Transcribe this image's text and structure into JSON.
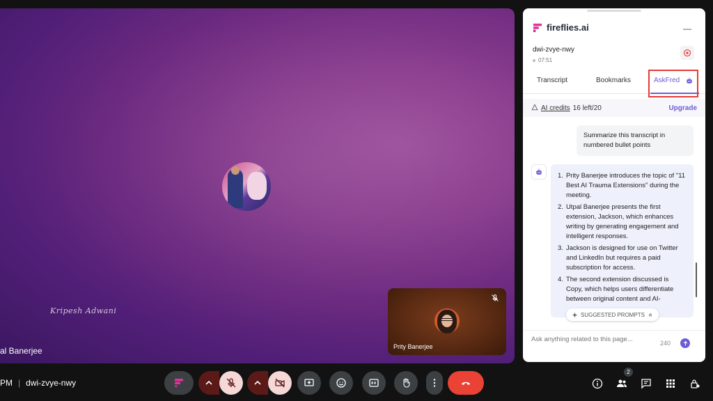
{
  "meeting": {
    "code": "dwi-zvye-nwy",
    "time_fragment": "PM",
    "separator": "|"
  },
  "main_video": {
    "participant_name": "al Banerjee",
    "signature": "Kripesh Adwani"
  },
  "self_video": {
    "participant_name": "Prity Banerjee"
  },
  "toolbar": {
    "people_badge": "2",
    "colors": {
      "warn_dark": "#5b1a18",
      "warn_light": "#f6d9d7",
      "end_call": "#ea4335",
      "button_bg": "#3c4043"
    }
  },
  "panel": {
    "brand_name": "fireflies.ai",
    "minimize_symbol": "—",
    "meeting_id": "dwi-zvye-nwy",
    "elapsed": "07:51",
    "tabs": [
      {
        "label": "Transcript"
      },
      {
        "label": "Bookmarks"
      },
      {
        "label": "AskFred"
      }
    ],
    "active_tab": "AskFred",
    "credits": {
      "label": "AI credits",
      "value": "16 left/20",
      "upgrade": "Upgrade"
    },
    "user_message": "Summarize this transcript in numbered bullet points",
    "bot_points": [
      {
        "num": "1.",
        "text": "Prity Banerjee introduces the topic of \"11 Best AI Trauma Extensions\" during the meeting."
      },
      {
        "num": "2.",
        "text": "Utpal Banerjee presents the first extension, Jackson, which enhances writing by generating engagement and intelligent responses."
      },
      {
        "num": "3.",
        "text": "Jackson is designed for use on Twitter and LinkedIn but requires a paid subscription for access."
      },
      {
        "num": "4.",
        "text": "The second extension discussed is Copy, which helps users differentiate between original content and AI-"
      }
    ],
    "suggested_prompts": "SUGGESTED PROMPTS",
    "ask_placeholder": "Ask anything related to this page...",
    "char_count": "240",
    "accent_color": "#6d5dd3",
    "highlight_color": "#e53935"
  }
}
